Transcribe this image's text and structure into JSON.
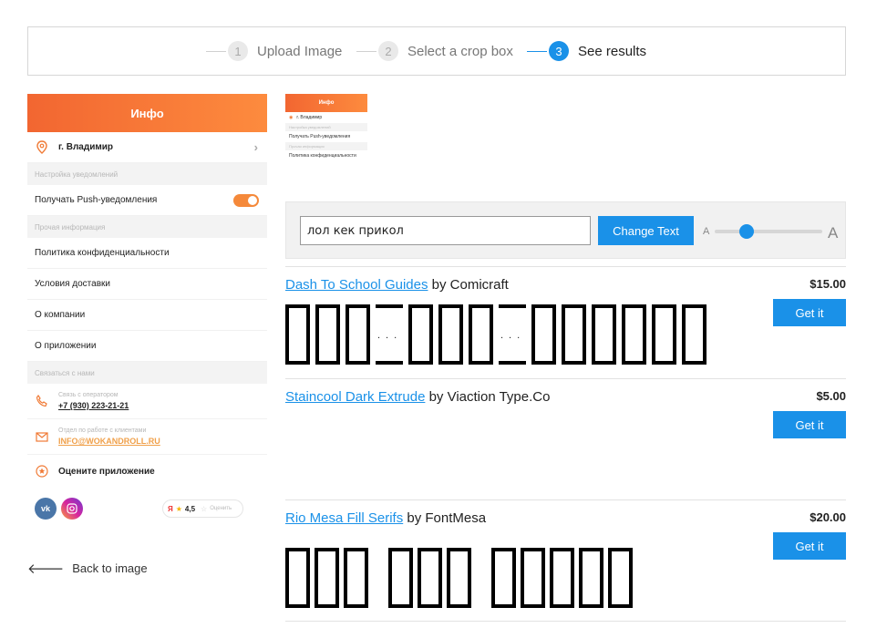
{
  "stepper": {
    "steps": [
      {
        "num": "1",
        "label": "Upload Image"
      },
      {
        "num": "2",
        "label": "Select a crop box"
      },
      {
        "num": "3",
        "label": "See results"
      }
    ]
  },
  "phone": {
    "header": "Инфо",
    "city": "г. Владимир",
    "section_notifications": "Настройка уведомлений",
    "push_label": "Получать Push-уведомления",
    "section_other": "Прочая информация",
    "privacy": "Политика конфиденциальности",
    "delivery": "Условия доставки",
    "about": "О компании",
    "about_app": "О приложении",
    "section_contact": "Связаться с нами",
    "operator_small": "Связь с оператором",
    "operator_phone": "+7 (930) 223-21-21",
    "support_small": "Отдел по работе с клиентами",
    "support_email": "INFO@WOKANDROLL.RU",
    "rate_app": "Оцените приложение",
    "rating_value": "4,5",
    "rating_action": "Оценить"
  },
  "back_link": "Back to image",
  "thumb": {
    "header": "Инфо",
    "city": "г. Владимир",
    "sec1": "Настройка уведомлений",
    "push": "Получать Push-уведомления",
    "sec2": "Прочая информация",
    "privacy": "Политика конфиденциальности"
  },
  "controls": {
    "input_value": "лол кек прикол",
    "change_button": "Change Text",
    "size_small": "A",
    "size_large": "A",
    "size_level": 0.3
  },
  "results": [
    {
      "name": "Dash To School Guides",
      "by": "by Comicraft",
      "price": "$15.00",
      "button": "Get it"
    },
    {
      "name": "Staincool Dark Extrude",
      "by": "by Viaction Type.Co",
      "price": "$5.00",
      "button": "Get it"
    },
    {
      "name": "Rio Mesa Fill Serifs",
      "by": "by FontMesa",
      "price": "$20.00",
      "button": "Get it"
    }
  ],
  "colors": {
    "accent": "#1a91e8",
    "orange": "#f26631"
  }
}
